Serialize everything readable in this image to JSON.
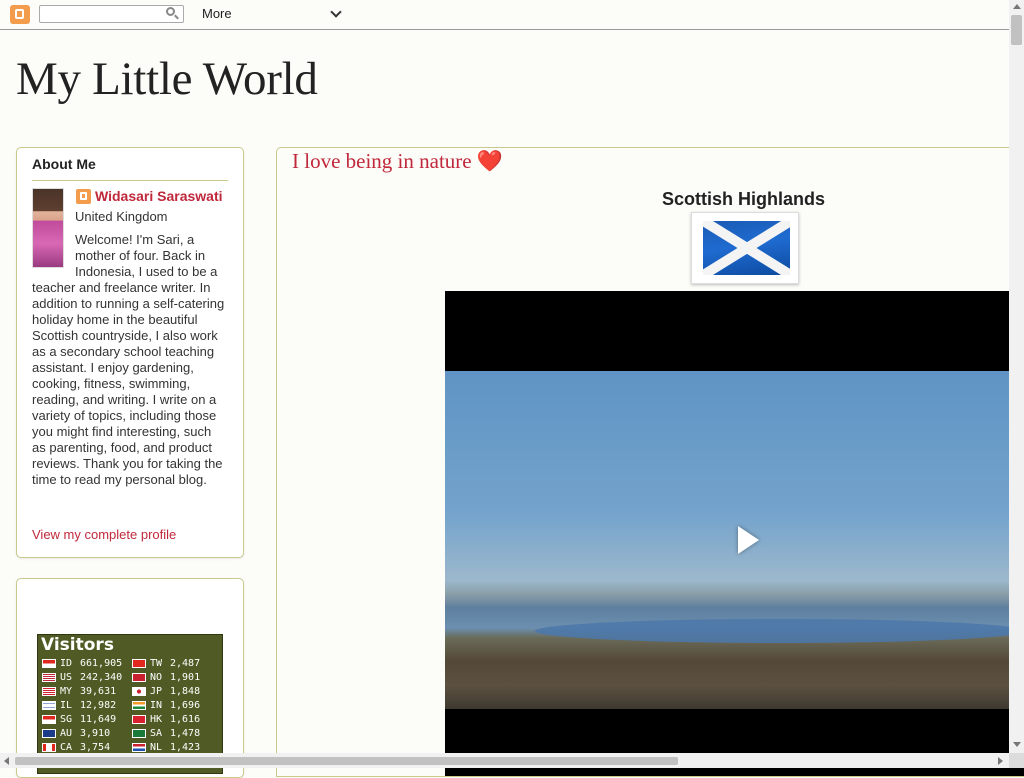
{
  "navbar": {
    "more_label": "More",
    "search_value": ""
  },
  "blog": {
    "title": "My Little World"
  },
  "about": {
    "heading": "About Me",
    "name": "Widasari Saraswati",
    "location": "United Kingdom",
    "bio": "Welcome! I'm Sari, a mother of four. Back in Indonesia, I used to be a teacher and freelance writer. In addition to running a self-catering holiday home in the beautiful Scottish countryside, I also work as a secondary school teaching assistant. I enjoy gardening, cooking, fitness, swimming, reading, and writing. I write on a variety of topics, including those you might find interesting, such as parenting, food, and product reviews. Thank you for taking the time to read my personal blog.",
    "profile_link": "View my complete profile"
  },
  "visitors": {
    "title": "Visitors",
    "left": [
      {
        "code": "ID",
        "count": "661,905"
      },
      {
        "code": "US",
        "count": "242,340"
      },
      {
        "code": "MY",
        "count": "39,631"
      },
      {
        "code": "IL",
        "count": "12,982"
      },
      {
        "code": "SG",
        "count": "11,649"
      },
      {
        "code": "AU",
        "count": "3,910"
      },
      {
        "code": "CA",
        "count": "3,754"
      }
    ],
    "right": [
      {
        "code": "TW",
        "count": "2,487"
      },
      {
        "code": "NO",
        "count": "1,901"
      },
      {
        "code": "JP",
        "count": "1,848"
      },
      {
        "code": "IN",
        "count": "1,696"
      },
      {
        "code": "HK",
        "count": "1,616"
      },
      {
        "code": "SA",
        "count": "1,478"
      },
      {
        "code": "NL",
        "count": "1,423"
      }
    ]
  },
  "post": {
    "title": "I love being in nature ❤️️️️",
    "section_heading": "Scottish Highlands"
  },
  "colors": {
    "accent": "#c0283b",
    "border": "#c9c98a",
    "blogger_orange": "#f39c4b",
    "counter_bg": "#4f5a24"
  }
}
